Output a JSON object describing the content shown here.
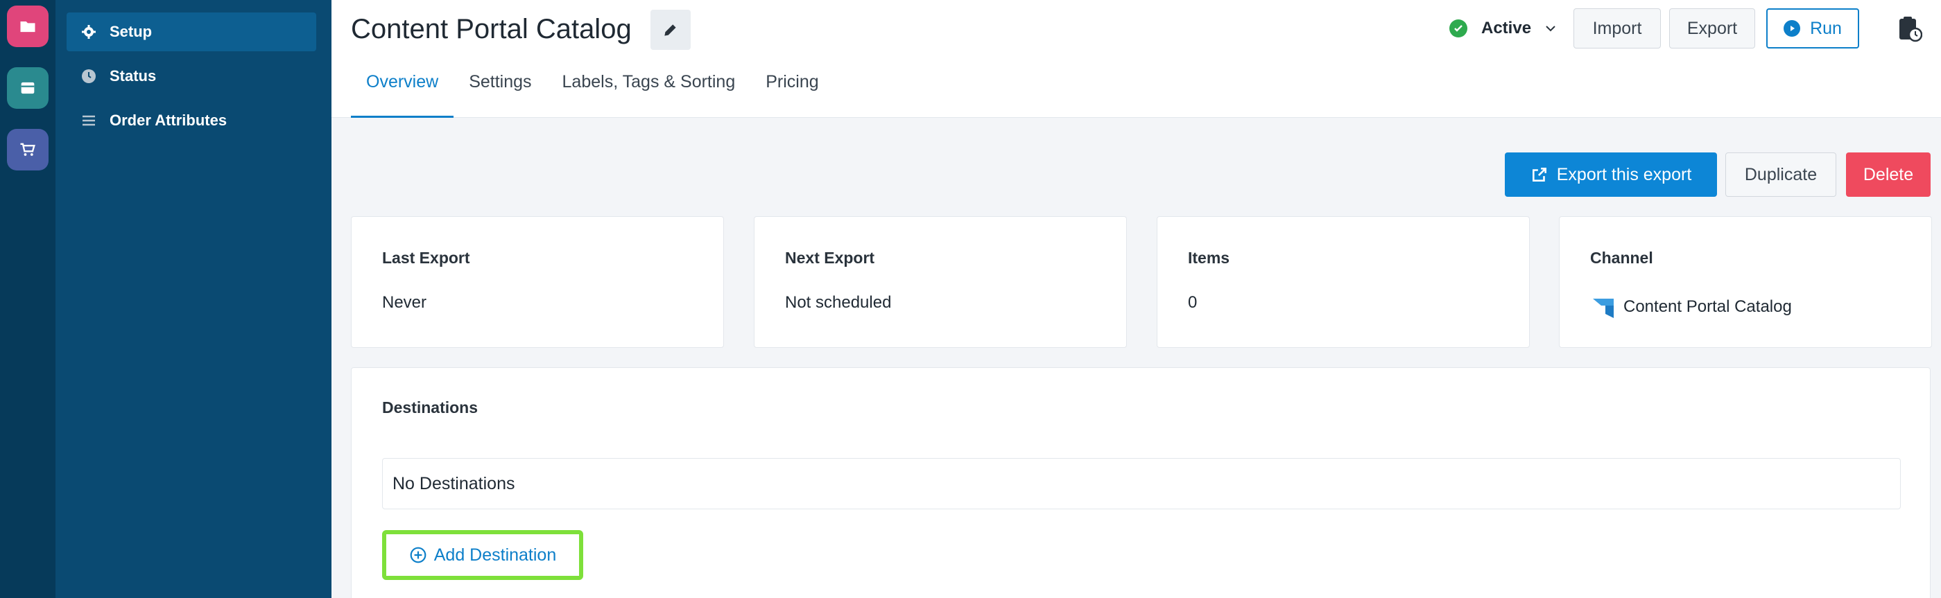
{
  "rail": {
    "items": [
      {
        "icon": "folder-icon",
        "color": "#e0457b"
      },
      {
        "icon": "inbox-icon",
        "color": "#2a8a8f"
      },
      {
        "icon": "cart-icon",
        "color": "#4a5fa8"
      }
    ]
  },
  "sidebar": {
    "items": [
      {
        "label": "Setup",
        "icon": "gear-icon",
        "active": true
      },
      {
        "label": "Status",
        "icon": "clock-icon",
        "active": false
      },
      {
        "label": "Order Attributes",
        "icon": "list-icon",
        "active": false
      }
    ]
  },
  "header": {
    "title": "Content Portal Catalog",
    "status": "Active",
    "import_label": "Import",
    "export_label": "Export",
    "run_label": "Run"
  },
  "tabs": [
    {
      "label": "Overview",
      "active": true
    },
    {
      "label": "Settings",
      "active": false
    },
    {
      "label": "Labels, Tags & Sorting",
      "active": false
    },
    {
      "label": "Pricing",
      "active": false
    }
  ],
  "actions": {
    "export_this": "Export this export",
    "duplicate": "Duplicate",
    "delete": "Delete"
  },
  "stats": [
    {
      "label": "Last Export",
      "value": "Never"
    },
    {
      "label": "Next Export",
      "value": "Not scheduled"
    },
    {
      "label": "Items",
      "value": "0"
    },
    {
      "label": "Channel",
      "value": "Content Portal Catalog"
    }
  ],
  "destinations": {
    "title": "Destinations",
    "empty": "No Destinations",
    "add_label": "Add Destination"
  },
  "colors": {
    "accent": "#0d7fc9",
    "danger": "#ef4a5e",
    "success": "#2eaa4e",
    "highlight": "#7ee03a"
  }
}
